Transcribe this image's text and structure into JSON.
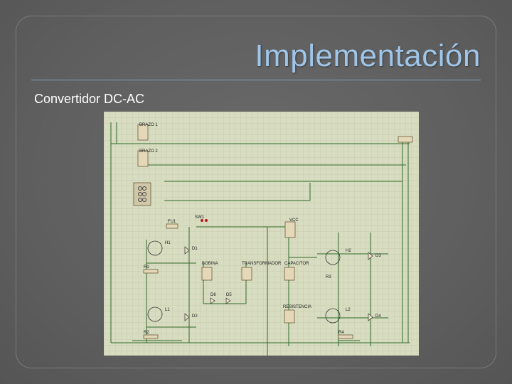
{
  "slide": {
    "title": "Implementación",
    "subtitle": "Convertidor DC-AC"
  },
  "schematic": {
    "labels": {
      "brazo1": "BRAZO 1",
      "brazo2": "BRAZO 2",
      "fu1": "FU1",
      "sw1": "SW1",
      "vcc": "VCC",
      "h1": "H1",
      "d1": "D1",
      "r1": "R1",
      "bobina": "BOBINA",
      "transformador": "TRANSFORMADOR",
      "capacitor": "CAPACITOR",
      "l1": "L1",
      "d2": "D2",
      "r2": "R2",
      "d6": "D6",
      "d5": "D5",
      "resistencia": "RESISTENCIA",
      "r4": "R4",
      "h2": "H2",
      "r3": "R3",
      "l2": "L2",
      "d3": "D3",
      "d4": "D4",
      "d4b": "D4"
    }
  },
  "colors": {
    "background": "#5e5e5e",
    "title": "#9fc5e8",
    "rule": "#7fa0b8",
    "subtitle": "#ffffff",
    "schematic_bg": "#d8dcc0",
    "wire": "#2f6a2a"
  }
}
